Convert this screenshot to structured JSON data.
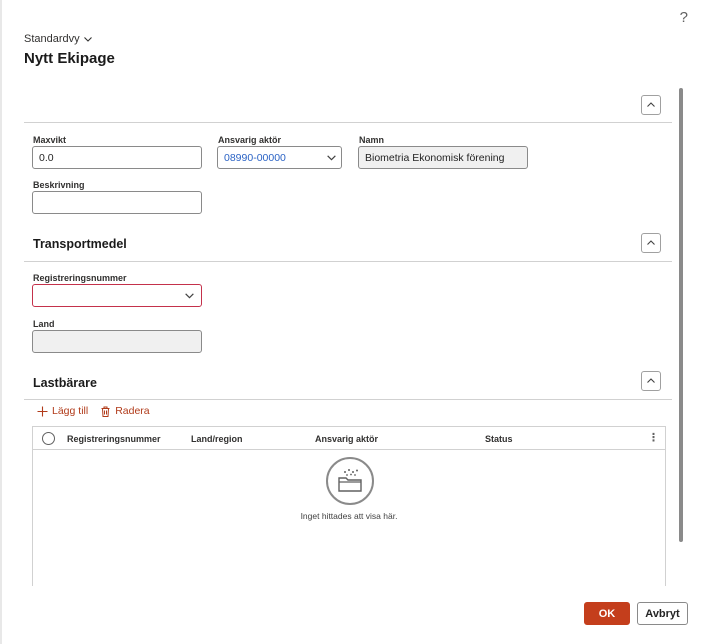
{
  "header": {
    "help_glyph": "?",
    "view_selector": "Standardvy",
    "title": "Nytt Ekipage"
  },
  "general": {
    "maxvikt": {
      "label": "Maxvikt",
      "value": "0.0"
    },
    "ansvarig_aktor": {
      "label": "Ansvarig aktör",
      "value": "08990-00000"
    },
    "namn": {
      "label": "Namn",
      "value": "Biometria Ekonomisk förening"
    },
    "beskrivning": {
      "label": "Beskrivning",
      "value": ""
    }
  },
  "transportmedel": {
    "title": "Transportmedel",
    "registreringsnummer": {
      "label": "Registreringsnummer",
      "value": ""
    },
    "land": {
      "label": "Land",
      "value": ""
    }
  },
  "lastbarare": {
    "title": "Lastbärare",
    "add_label": "Lägg till",
    "delete_label": "Radera",
    "columns": [
      "Registreringsnummer",
      "Land/region",
      "Ansvarig aktör",
      "Status"
    ],
    "empty_text": "Inget hittades att visa här."
  },
  "footer": {
    "ok_label": "OK",
    "cancel_label": "Avbryt"
  },
  "colors": {
    "accent": "#c43e1c",
    "lookup_text": "#2b63c5",
    "error_border": "#c4314b"
  }
}
